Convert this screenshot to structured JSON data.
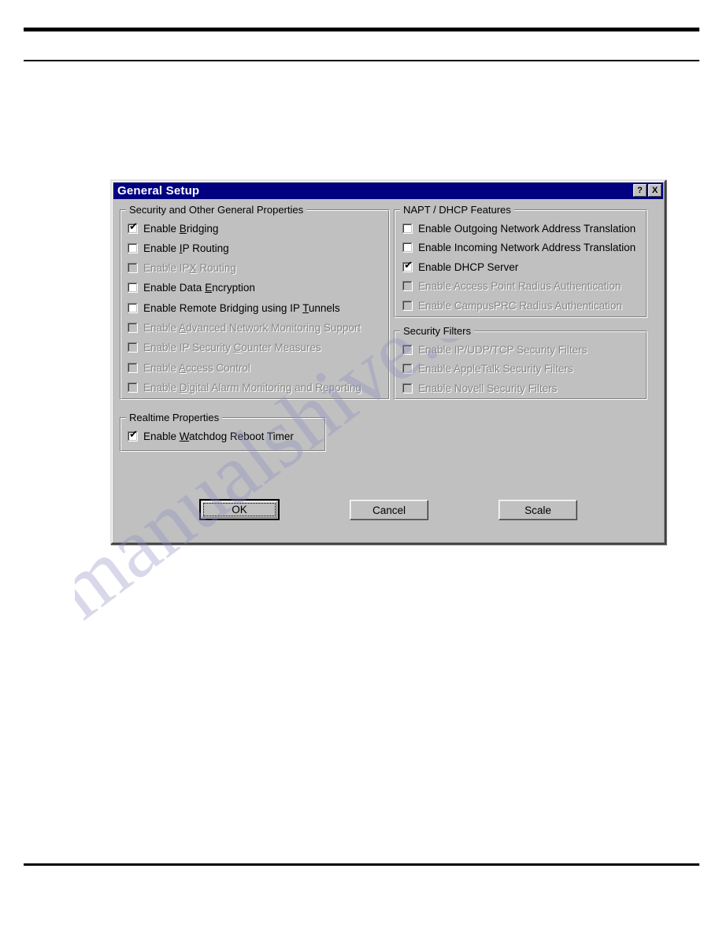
{
  "page": {
    "rules": [
      "top-thick",
      "top-thin",
      "bottom"
    ],
    "watermark_text": "manualshive.com"
  },
  "dialog": {
    "title": "General Setup",
    "titlebar_color": "#000080",
    "face_color": "#c0c0c0",
    "help_button": "?",
    "close_button": "X",
    "groups": {
      "security": {
        "title": "Security and Other General Properties",
        "items": [
          {
            "label_pre": "Enable ",
            "accel": "B",
            "label_post": "ridging",
            "checked": true,
            "disabled": false
          },
          {
            "label_pre": "Enable ",
            "accel": "I",
            "label_post": "P Routing",
            "checked": false,
            "disabled": false
          },
          {
            "label_pre": "Enable IP",
            "accel": "X",
            "label_post": " Routing",
            "checked": false,
            "disabled": true
          },
          {
            "label_pre": "Enable Data ",
            "accel": "E",
            "label_post": "ncryption",
            "checked": false,
            "disabled": false
          },
          {
            "label_pre": "Enable Remote Bridging using IP ",
            "accel": "T",
            "label_post": "unnels",
            "checked": false,
            "disabled": false
          },
          {
            "label_pre": "Enable ",
            "accel": "A",
            "label_post": "dvanced Network Monitoring Support",
            "checked": false,
            "disabled": true
          },
          {
            "label_pre": "Enable IP Security ",
            "accel": "C",
            "label_post": "ounter Measures",
            "checked": false,
            "disabled": true
          },
          {
            "label_pre": "Enable ",
            "accel": "A",
            "label_post": "ccess Control",
            "checked": false,
            "disabled": true
          },
          {
            "label_pre": "Enable ",
            "accel": "D",
            "label_post": "igital Alarm Monitoring and Reporting",
            "checked": false,
            "disabled": true
          }
        ]
      },
      "napt": {
        "title": "NAPT / DHCP Features",
        "items": [
          {
            "label_pre": "Enable Outgoing Network Address Translation",
            "accel": "",
            "label_post": "",
            "checked": false,
            "disabled": false
          },
          {
            "label_pre": "Enable Incoming Network Address Translation",
            "accel": "",
            "label_post": "",
            "checked": false,
            "disabled": false
          },
          {
            "label_pre": "Enable DHCP Server",
            "accel": "",
            "label_post": "",
            "checked": true,
            "disabled": false
          },
          {
            "label_pre": "Enable Access Point Radius Authentication",
            "accel": "",
            "label_post": "",
            "checked": false,
            "disabled": true
          },
          {
            "label_pre": "Enable CampusPRC Radius Authentication",
            "accel": "",
            "label_post": "",
            "checked": false,
            "disabled": true
          }
        ]
      },
      "filters": {
        "title": "Security Filters",
        "items": [
          {
            "label_pre": "Enable IP/UDP/TCP Security Filters",
            "accel": "",
            "label_post": "",
            "checked": false,
            "disabled": true
          },
          {
            "label_pre": "Enable AppleTalk Security Filters",
            "accel": "",
            "label_post": "",
            "checked": false,
            "disabled": true
          },
          {
            "label_pre": "Enable Novell Security Filters",
            "accel": "",
            "label_post": "",
            "checked": false,
            "disabled": true
          }
        ]
      },
      "realtime": {
        "title": "Realtime Properties",
        "items": [
          {
            "label_pre": "Enable ",
            "accel": "W",
            "label_post": "atchdog Reboot Timer",
            "checked": true,
            "disabled": false
          }
        ]
      }
    },
    "buttons": {
      "ok": "OK",
      "cancel": "Cancel",
      "scale": "Scale"
    }
  }
}
